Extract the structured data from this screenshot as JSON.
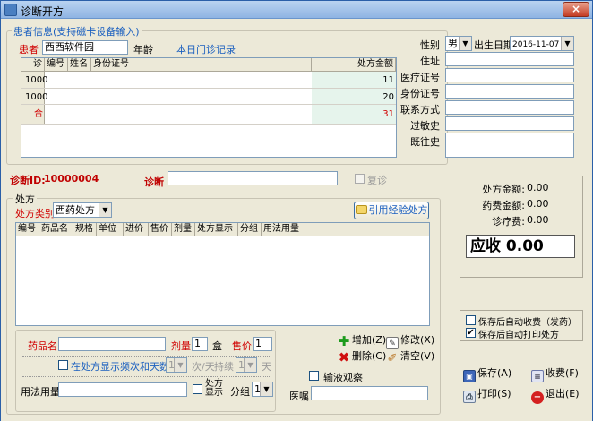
{
  "window": {
    "title": "诊断开方",
    "close_label": "×"
  },
  "patient": {
    "group_label": "患者信息(支持磁卡设备输入)",
    "patient_label": "患者",
    "patient_value": "西西软件园",
    "age_label": "年龄",
    "age_value": "",
    "today_link": "本日门诊记录",
    "gender_label": "性别",
    "gender_value": "男",
    "birth_label": "出生日期",
    "birth_value": "2016-11-07",
    "address_label": "住址",
    "insurance_label": "医疗证号",
    "idcard_label": "身份证号",
    "contact_label": "联系方式",
    "allergy_label": "过敏史",
    "history_label": "既往史"
  },
  "records_table": {
    "columns": [
      "诊",
      "编号",
      "姓名",
      "身份证号",
      "处方金额"
    ],
    "rows": [
      {
        "diag": "1000",
        "amount": "11"
      },
      {
        "diag": "1000",
        "amount": "20"
      },
      {
        "diag": "合",
        "amount": "31"
      }
    ]
  },
  "diagnosis": {
    "id_label": "诊断ID:",
    "id_value": "10000004",
    "diag_label": "诊断",
    "diag_value": "",
    "revisit_label": "复诊"
  },
  "prescription": {
    "group_label": "处方",
    "type_label": "处方类别",
    "type_value": "西药处方",
    "cite_button": "引用经验处方",
    "columns": [
      "编号",
      "药品名",
      "规格",
      "单位",
      "进价",
      "售价",
      "剂量",
      "处方显示",
      "分组",
      "用法用量"
    ]
  },
  "drug_entry": {
    "drug_name_label": "药品名",
    "dose_label": "剂量",
    "dose_value": "1",
    "dose_unit": "盒",
    "price_label": "售价",
    "price_value": "1",
    "show_freq_label": "在处方显示频次和天数",
    "freq_value": "1",
    "freq_unit": "次/天",
    "duration_label": "持续",
    "duration_value": "1",
    "duration_unit": "天",
    "usage_label": "用法用量",
    "rx_show_label": "处方显示",
    "group_label": "分组",
    "group_value": "1"
  },
  "actions": {
    "add": "增加(Z)",
    "modify": "修改(X)",
    "delete": "删除(C)",
    "clear": "清空(V)",
    "infusion_label": "输液观察",
    "advice_label": "医嘱"
  },
  "summary": {
    "rx_amount_label": "处方金额:",
    "rx_amount_value": "0.00",
    "drug_fee_label": "药费金额:",
    "drug_fee_value": "0.00",
    "treat_fee_label": "诊疗费:",
    "treat_fee_value": "0.00",
    "receivable": "应收 0.00"
  },
  "options": {
    "auto_charge": "保存后自动收费（发药）",
    "auto_print": "保存后自动打印处方",
    "auto_print_checked": "✔"
  },
  "buttons": {
    "save": "保存(A)",
    "charge": "收费(F)",
    "print": "打印(S)",
    "exit": "退出(E)"
  },
  "colors": {
    "accent": "#1a5fbf",
    "danger": "#d00000",
    "title_bg": "#8fb4e3"
  }
}
